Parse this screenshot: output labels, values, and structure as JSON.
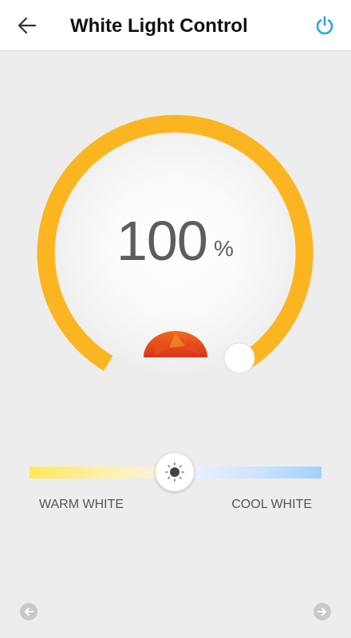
{
  "header": {
    "title": "White Light Control",
    "back_icon": "arrow-left-icon",
    "power_icon": "power-icon",
    "accent_color": "#29a8d8"
  },
  "brightness": {
    "value": "100",
    "unit": "%",
    "level_percent": 100,
    "arc_color": "#fbb520"
  },
  "color_temperature": {
    "warm_label": "WARM WHITE",
    "cool_label": "COOL WHITE",
    "position_fraction": 0.5,
    "warm_color": "#ffe85a",
    "cool_color": "#9fd0ff",
    "thumb_icon": "sun-icon"
  },
  "logo": {
    "icon": "jellyfish-icon"
  },
  "footer": {
    "prev_icon": "arrow-left-circle-icon",
    "next_icon": "arrow-right-circle-icon"
  }
}
